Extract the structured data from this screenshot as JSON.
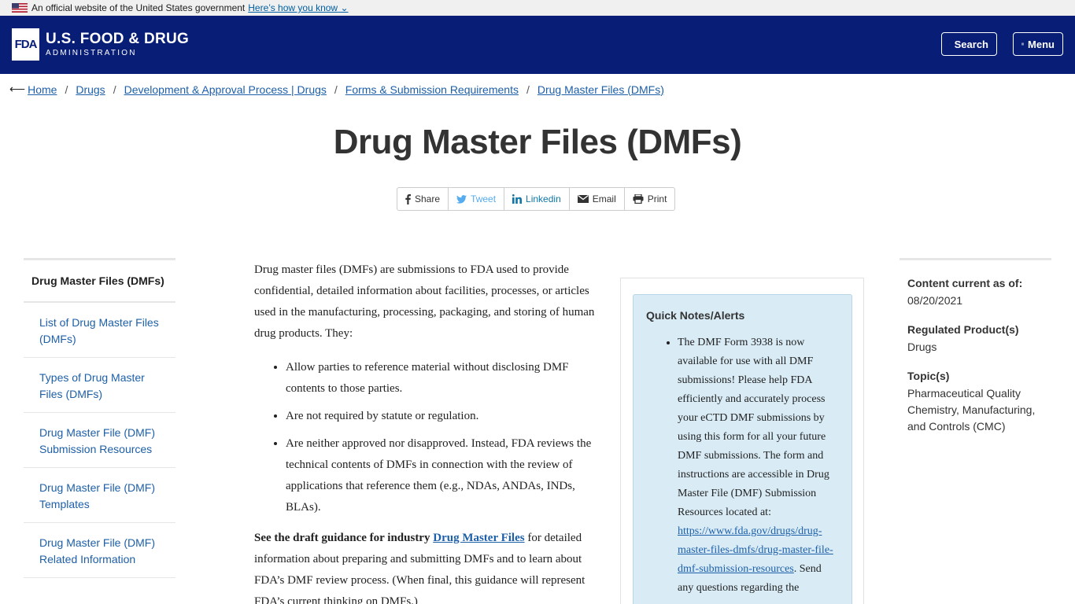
{
  "gov_banner": {
    "text": "An official website of the United States government",
    "link": "Here’s how you know"
  },
  "header": {
    "logo_mark": "FDA",
    "logo_line1": "U.S. FOOD & DRUG",
    "logo_line2": "ADMINISTRATION",
    "search_label": "Search",
    "menu_label": "Menu"
  },
  "breadcrumb": [
    "Home",
    "Drugs",
    "Development & Approval Process | Drugs",
    "Forms & Submission Requirements",
    "Drug Master Files (DMFs)"
  ],
  "page_title": "Drug Master Files (DMFs)",
  "share": {
    "share": "Share",
    "tweet": "Tweet",
    "linkedin": "Linkedin",
    "email": "Email",
    "print": "Print"
  },
  "left_nav": {
    "heading": "Drug Master Files (DMFs)",
    "items": [
      "List of Drug Master Files (DMFs)",
      "Types of Drug Master Files (DMFs)",
      "Drug Master File (DMF) Submission Resources",
      "Drug Master File (DMF) Templates",
      "Drug Master File (DMF) Related Information"
    ]
  },
  "main": {
    "intro": "Drug master files (DMFs) are submissions to FDA used to provide confidential, detailed information about facilities, processes, or articles used in the manufacturing, processing, packaging, and storing of human drug products. They:",
    "bullets": [
      "Allow parties to reference material without disclosing DMF contents to those parties.",
      "Are not required by statute or regulation.",
      "Are neither approved nor disapproved. Instead, FDA reviews the technical contents of DMFs in connection with the review of applications that reference them (e.g., NDAs, ANDAs, INDs, BLAs)."
    ],
    "guidance_bold": "See the draft guidance for industry",
    "guidance_link": "Drug Master Files",
    "guidance_rest": "for detailed information about preparing and submitting DMFs and to learn about FDA’s DMF review process. (When final, this guidance will represent FDA’s current thinking on DMFs.)"
  },
  "quick_notes": {
    "title": "Quick Notes/Alerts",
    "text_before": "The DMF Form 3938 is now available for use with all DMF submissions!  Please help FDA efficiently and accurately process your eCTD DMF submissions by using this form for all your future DMF submissions.  The form and instructions are accessible in Drug Master File (DMF) Submission Resources located at:",
    "link": "https://www.fda.gov/drugs/drug-master-files-dmfs/drug-master-file-dmf-submission-resources",
    "text_after": ".  Send any questions regarding the"
  },
  "right_side": {
    "current_label": "Content current as of:",
    "current_value": "08/20/2021",
    "regulated_label": "Regulated Product(s)",
    "regulated_value": "Drugs",
    "topic_label": "Topic(s)",
    "topic_value": "Pharmaceutical Quality Chemistry, Manufacturing, and Controls (CMC)"
  },
  "colors": {
    "header_bg": "#071d76",
    "link": "#1d5fa8",
    "quick_notes_bg": "#d9ecf6"
  }
}
